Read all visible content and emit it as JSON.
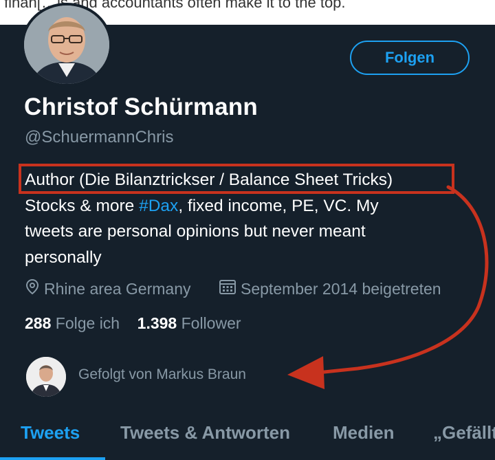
{
  "top_snippet": "finan[…]s and accountants often make it to the top.",
  "profile": {
    "name": "Christof Schürmann",
    "handle": "@SchuermannChris",
    "follow_label": "Folgen",
    "bio_line1": "Author (Die Bilanztrickser / Balance Sheet Tricks)",
    "bio_line2_pre": "Stocks & more ",
    "bio_hashtag": "#Dax",
    "bio_line2_post": ", fixed income, PE, VC. My",
    "bio_line3": "tweets are personal opinions but never meant",
    "bio_line4": "personally",
    "location": "Rhine area Germany",
    "joined": "September 2014 beigetreten",
    "following_count": "288",
    "following_label": "Folge ich",
    "followers_count": "1.398",
    "followers_label": "Follower",
    "followed_by": "Gefolgt von Markus Braun"
  },
  "tabs": [
    {
      "label": "Tweets",
      "active": true
    },
    {
      "label": "Tweets & Antworten",
      "active": false
    },
    {
      "label": "Medien",
      "active": false
    },
    {
      "label": "„Gefällt",
      "active": false
    }
  ],
  "colors": {
    "background": "#15202b",
    "accent": "#1da1f2",
    "secondary_text": "#8899a6",
    "annotation": "#c8321e"
  },
  "icons": [
    "location-pin-icon",
    "calendar-icon"
  ]
}
